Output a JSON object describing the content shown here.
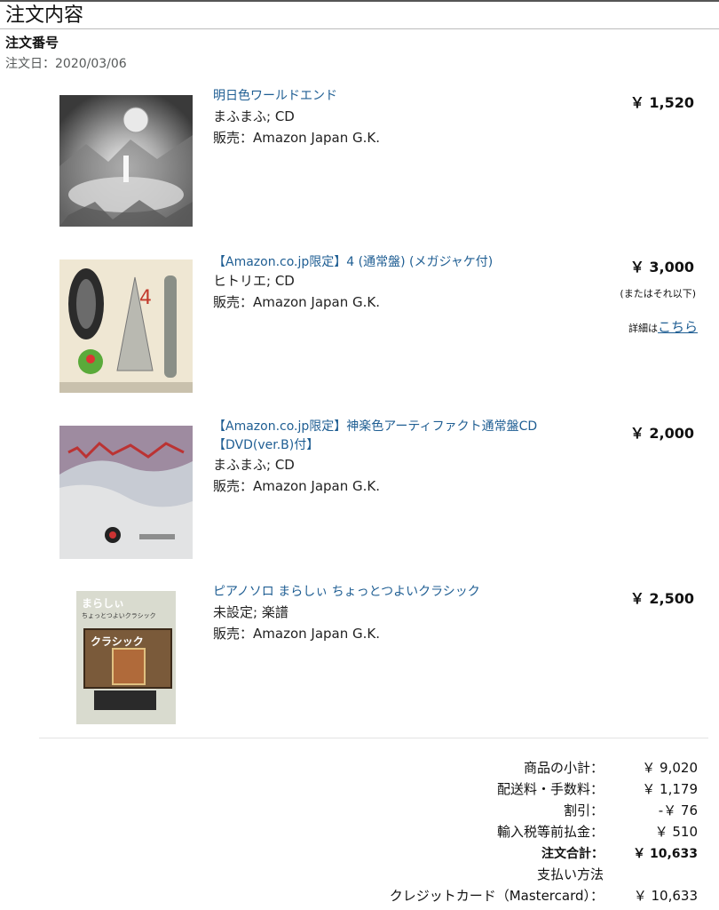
{
  "page": {
    "title": "注文内容",
    "order_number_label": "注文番号",
    "order_date": "注文日：2020/03/06"
  },
  "items": [
    {
      "title": "明日色ワールドエンド",
      "line1": "まふまふ; CD",
      "seller": "販売：Amazon Japan G.K.",
      "price": "￥ 1,520"
    },
    {
      "title": "【Amazon.co.jp限定】4 (通常盤) (メガジャケ付)",
      "line1": "ヒトリエ; CD",
      "seller": "販売：Amazon Japan G.K.",
      "price": "￥ 3,000",
      "price_note": "(またはそれ以下)",
      "detail_prefix": "詳細は",
      "detail_link": "こちら"
    },
    {
      "title": "【Amazon.co.jp限定】神楽色アーティファクト通常盤CD【DVD(ver.B)付】",
      "line1": "まふまふ; CD",
      "seller": "販売：Amazon Japan G.K.",
      "price": "￥ 2,000"
    },
    {
      "title": "ピアノソロ まらしぃ ちょっとつよいクラシック",
      "line1": "未設定; 楽譜",
      "seller": "販売：Amazon Japan G.K.",
      "price": "￥ 2,500",
      "cover_text_1": "まらしぃ",
      "cover_text_2": "ちょっとつよいクラシック",
      "cover_text_3": "クラシック"
    }
  ],
  "summary": {
    "subtotal_label": "商品の小計：",
    "subtotal_value": "￥ 9,020",
    "shipping_label": "配送料・手数料：",
    "shipping_value": "￥ 1,179",
    "discount_label": "割引：",
    "discount_value": "-￥ 76",
    "import_label": "輸入税等前払金：",
    "import_value": "￥ 510",
    "total_label": "注文合計：",
    "total_value": "￥ 10,633",
    "payment_heading": "支払い方法",
    "payment_label": "クレジットカード（Mastercard）：",
    "payment_value": "￥ 10,633"
  },
  "colors": {
    "link": "#1f5e93",
    "text": "#111111",
    "muted": "#565959",
    "divider": "#e3e3e3"
  }
}
